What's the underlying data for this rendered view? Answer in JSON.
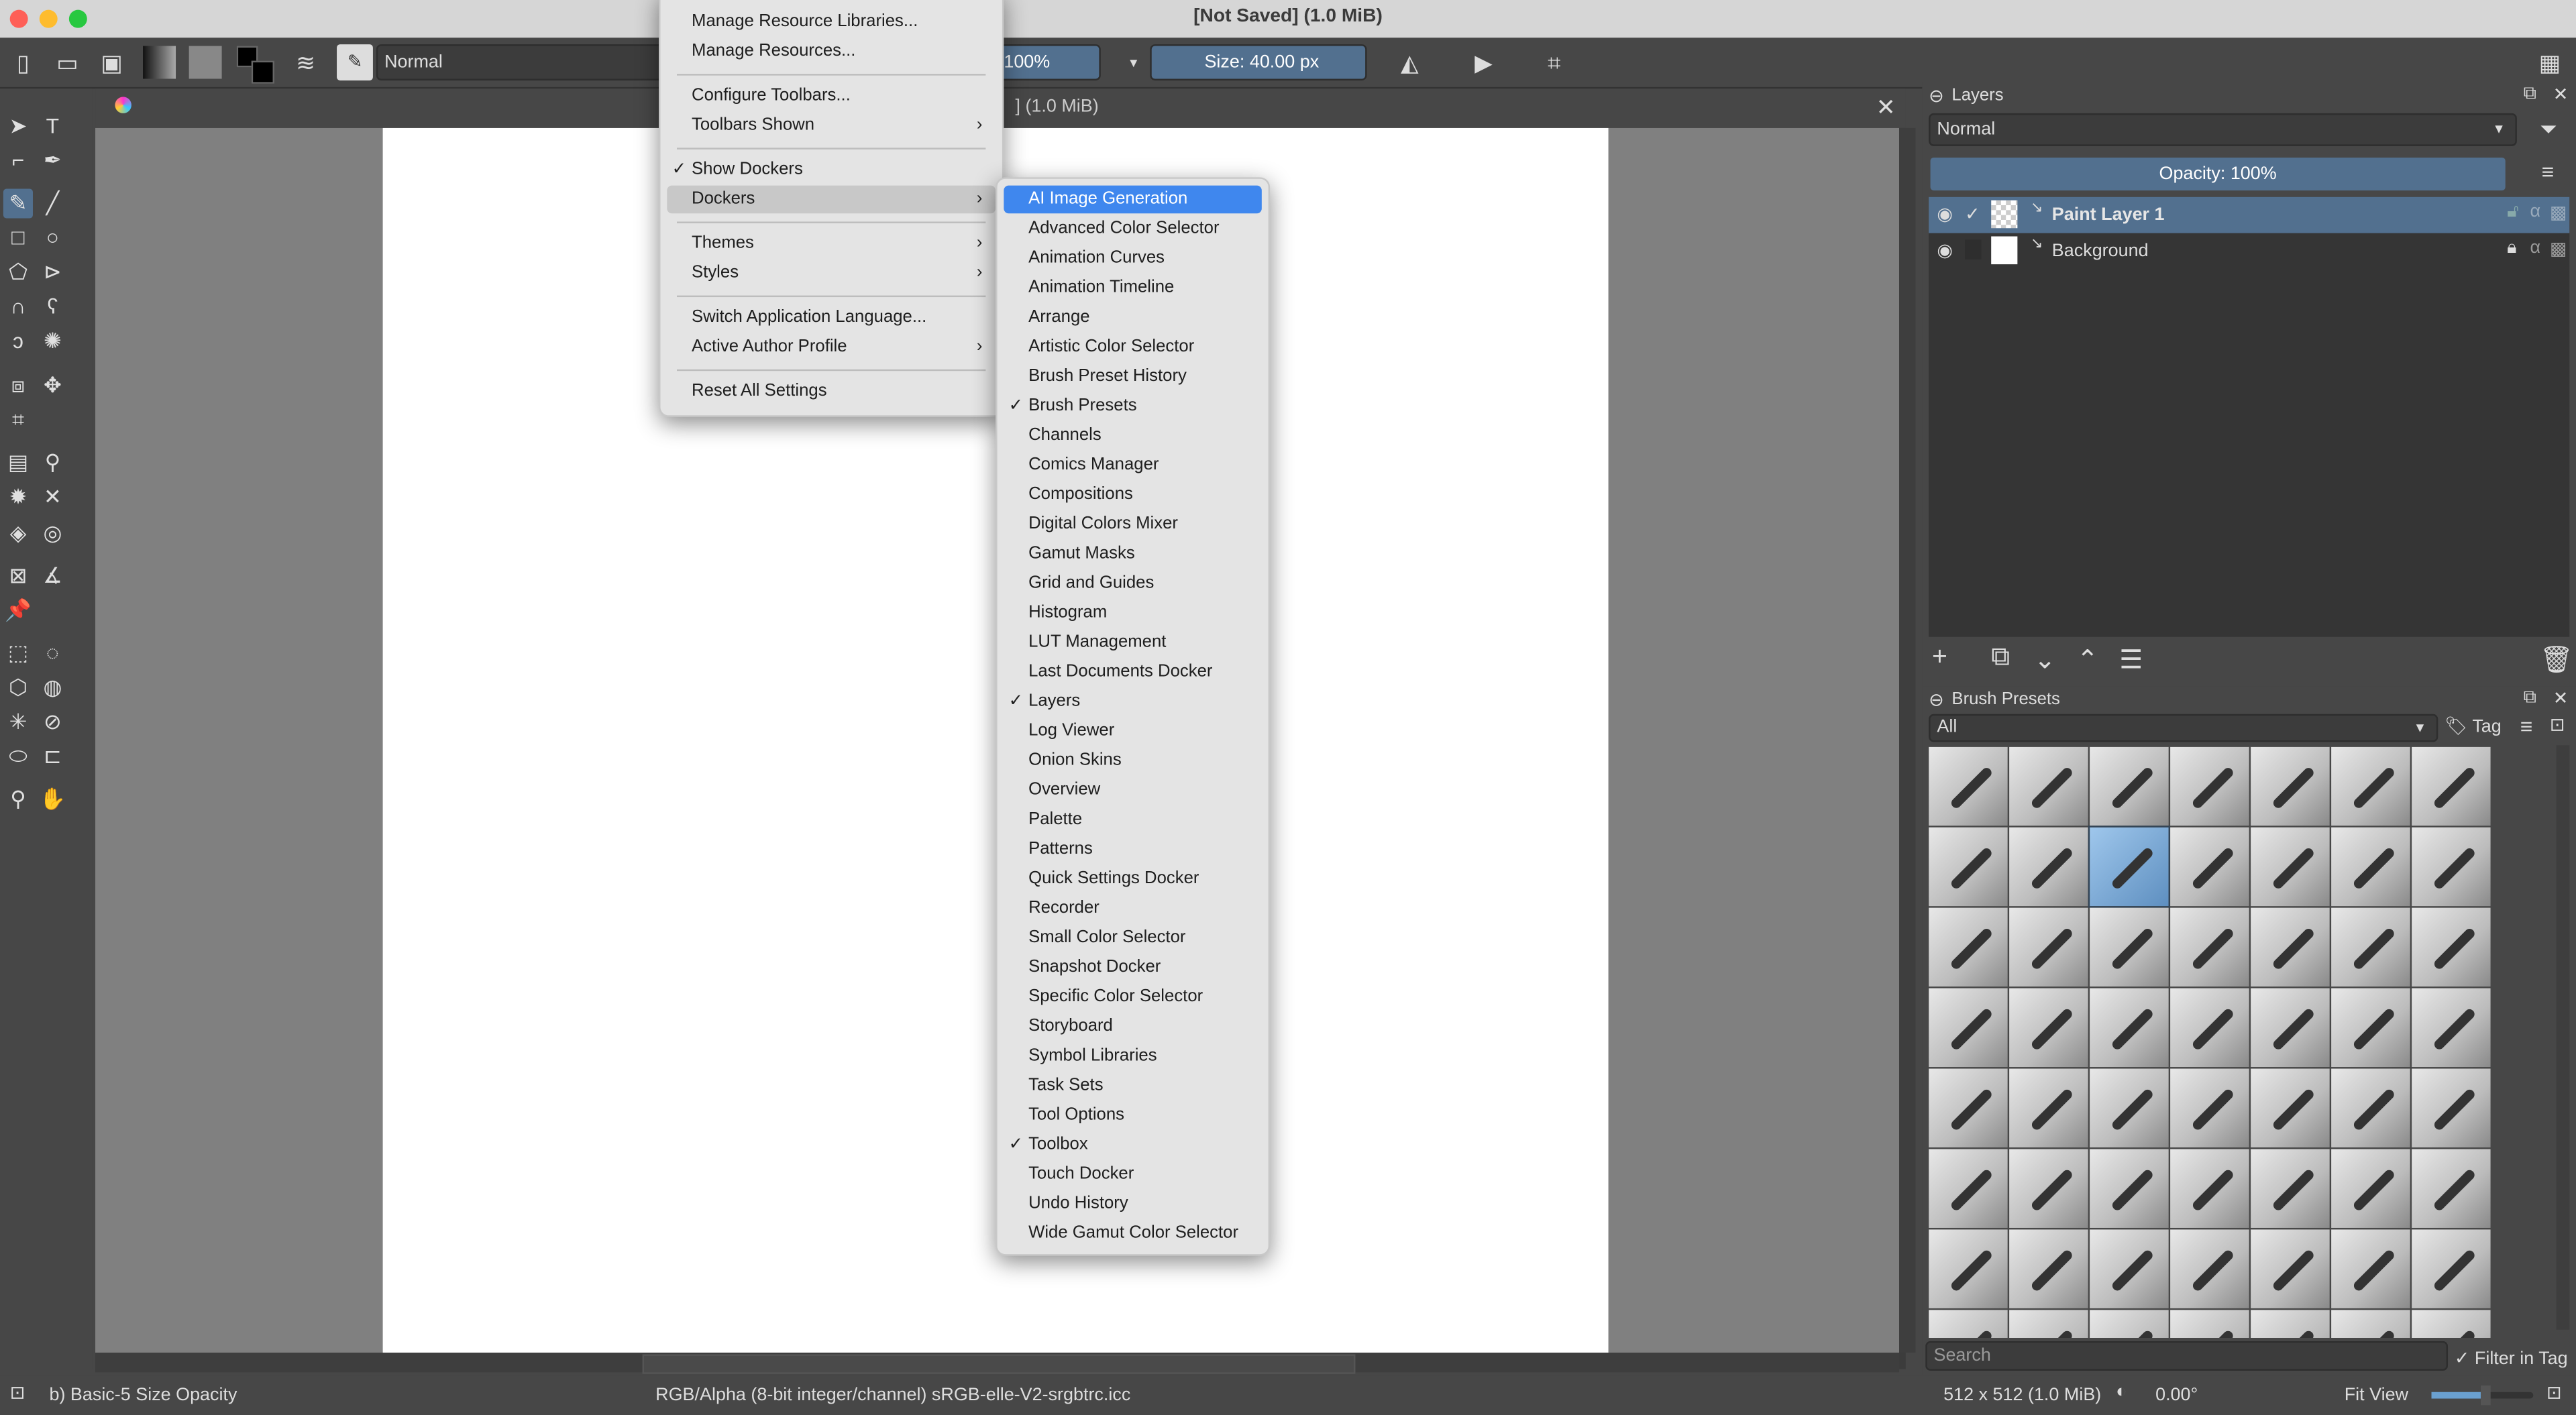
{
  "window": {
    "title": "[Not Saved]  (1.0 MiB)"
  },
  "toolbar": {
    "blend_mode": "Normal",
    "opacity": "100%",
    "size": "Size: 40.00 px"
  },
  "document_tab": {
    "title": "] (1.0 MiB)"
  },
  "settings_menu": {
    "items": [
      {
        "label": "Manage Resource Libraries..."
      },
      {
        "label": "Manage Resources..."
      },
      {
        "sep": true
      },
      {
        "label": "Configure Toolbars..."
      },
      {
        "label": "Toolbars Shown",
        "submenu": true
      },
      {
        "sep": true
      },
      {
        "label": "Show Dockers",
        "checked": true
      },
      {
        "label": "Dockers",
        "submenu": true,
        "highlighted": true
      },
      {
        "sep": true
      },
      {
        "label": "Themes",
        "submenu": true
      },
      {
        "label": "Styles",
        "submenu": true
      },
      {
        "sep": true
      },
      {
        "label": "Switch Application Language..."
      },
      {
        "label": "Active Author Profile",
        "submenu": true
      },
      {
        "sep": true
      },
      {
        "label": "Reset All Settings"
      }
    ]
  },
  "dockers_menu": {
    "items": [
      {
        "label": "AI Image Generation",
        "active": true
      },
      {
        "label": "Advanced Color Selector"
      },
      {
        "label": "Animation Curves"
      },
      {
        "label": "Animation Timeline"
      },
      {
        "label": "Arrange"
      },
      {
        "label": "Artistic Color Selector"
      },
      {
        "label": "Brush Preset History"
      },
      {
        "label": "Brush Presets",
        "checked": true
      },
      {
        "label": "Channels"
      },
      {
        "label": "Comics Manager"
      },
      {
        "label": "Compositions"
      },
      {
        "label": "Digital Colors Mixer"
      },
      {
        "label": "Gamut Masks"
      },
      {
        "label": "Grid and Guides"
      },
      {
        "label": "Histogram"
      },
      {
        "label": "LUT Management"
      },
      {
        "label": "Last Documents Docker"
      },
      {
        "label": "Layers",
        "checked": true
      },
      {
        "label": "Log Viewer"
      },
      {
        "label": "Onion Skins"
      },
      {
        "label": "Overview"
      },
      {
        "label": "Palette"
      },
      {
        "label": "Patterns"
      },
      {
        "label": "Quick Settings Docker"
      },
      {
        "label": "Recorder"
      },
      {
        "label": "Small Color Selector"
      },
      {
        "label": "Snapshot Docker"
      },
      {
        "label": "Specific Color Selector"
      },
      {
        "label": "Storyboard"
      },
      {
        "label": "Symbol Libraries"
      },
      {
        "label": "Task Sets"
      },
      {
        "label": "Tool Options"
      },
      {
        "label": "Toolbox",
        "checked": true
      },
      {
        "label": "Touch Docker"
      },
      {
        "label": "Undo History"
      },
      {
        "label": "Wide Gamut Color Selector"
      }
    ]
  },
  "layers_docker": {
    "title": "Layers",
    "blend_mode": "Normal",
    "opacity": "Opacity:  100%",
    "layers": [
      {
        "name": "Paint Layer 1",
        "selected": true,
        "visible": true
      },
      {
        "name": "Background",
        "selected": false,
        "visible": true,
        "locked": true
      }
    ]
  },
  "brush_presets_docker": {
    "title": "Brush Presets",
    "filter": "All",
    "tag_label": "Tag",
    "search_placeholder": "Search",
    "filter_in_tag": "Filter in Tag",
    "selected_index": 9
  },
  "statusbar": {
    "brush": "b) Basic-5 Size Opacity",
    "color_profile": "RGB/Alpha (8-bit integer/channel)  sRGB-elle-V2-srgbtrc.icc",
    "image_size": "512 x 512 (1.0 MiB)",
    "rotation": "0.00°",
    "zoom_mode": "Fit View"
  },
  "colors": {
    "accent": "#52708f",
    "menu_highlight": "#3f87ee",
    "panel": "#474747"
  }
}
